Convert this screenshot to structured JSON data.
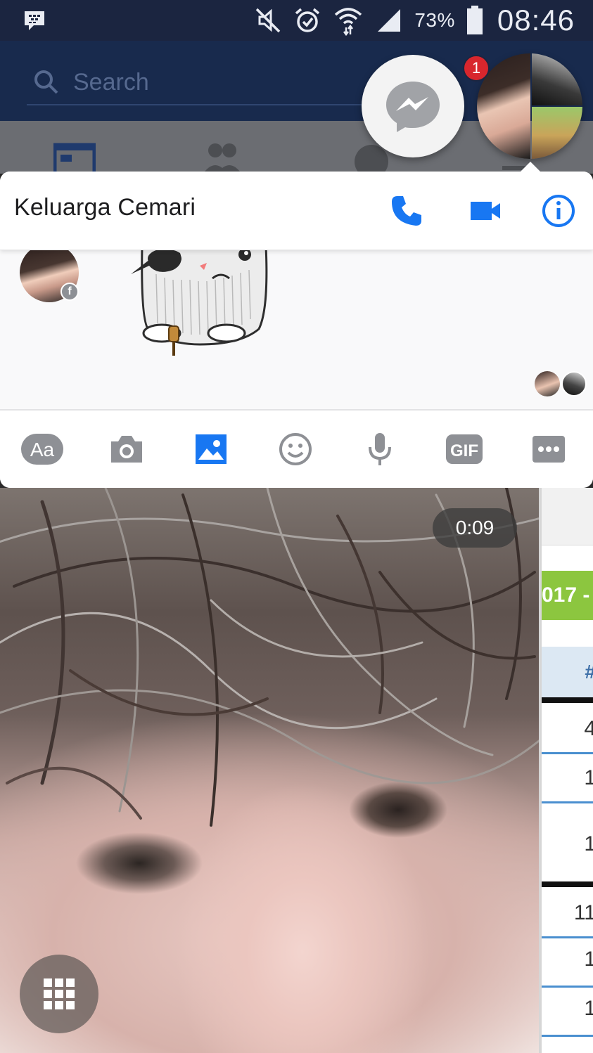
{
  "status_bar": {
    "battery_percent": "73%",
    "time": "08:46",
    "icons": [
      "bbm-icon",
      "mute-icon",
      "alarm-icon",
      "wifi-icon",
      "signal-icon",
      "battery-icon"
    ]
  },
  "facebook": {
    "search_placeholder": "Search",
    "tabs": [
      "news-feed-icon",
      "friends-icon",
      "globe-icon",
      "menu-icon"
    ]
  },
  "chat_heads": {
    "notification_count": "1"
  },
  "chat": {
    "title": "Keluarga Cemari",
    "header_actions": [
      "phone-icon",
      "video-call-icon",
      "info-icon"
    ],
    "composer": {
      "text_button": "Aa",
      "gif_label": "GIF",
      "buttons": [
        "text-button",
        "camera-button",
        "gallery-button",
        "emoji-button",
        "microphone-button",
        "gif-button",
        "more-button"
      ]
    },
    "accent_color": "#1877f2"
  },
  "video": {
    "timer": "0:09"
  },
  "background_sheet": {
    "banner_text": "017 -",
    "header_text": "#",
    "cells": [
      "4",
      "1",
      "1",
      "11",
      "1",
      "1"
    ]
  }
}
